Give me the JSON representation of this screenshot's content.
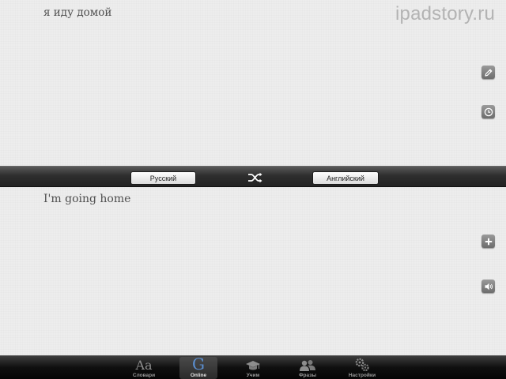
{
  "watermark": "ipadstory.ru",
  "source": {
    "text": "я иду домой",
    "buttons": [
      {
        "name": "edit-button",
        "icon": "pencil-icon"
      },
      {
        "name": "history-button",
        "icon": "clock-icon"
      }
    ]
  },
  "language_bar": {
    "from_label": "Русский",
    "to_label": "Английский",
    "swap_icon": "shuffle-icon"
  },
  "target": {
    "text": "I'm going home",
    "buttons": [
      {
        "name": "add-button",
        "icon": "plus-icon"
      },
      {
        "name": "speak-button",
        "icon": "speaker-icon"
      }
    ]
  },
  "tab_bar": {
    "tabs": [
      {
        "label": "Словари",
        "icon": "aa-icon",
        "active": false
      },
      {
        "label": "Online",
        "icon": "google-g-icon",
        "active": true
      },
      {
        "label": "Учим",
        "icon": "graduation-cap-icon",
        "active": false
      },
      {
        "label": "Фразы",
        "icon": "people-icon",
        "active": false
      },
      {
        "label": "Настройки",
        "icon": "gears-icon",
        "active": false
      }
    ],
    "active_color": "#5b8fd1"
  }
}
